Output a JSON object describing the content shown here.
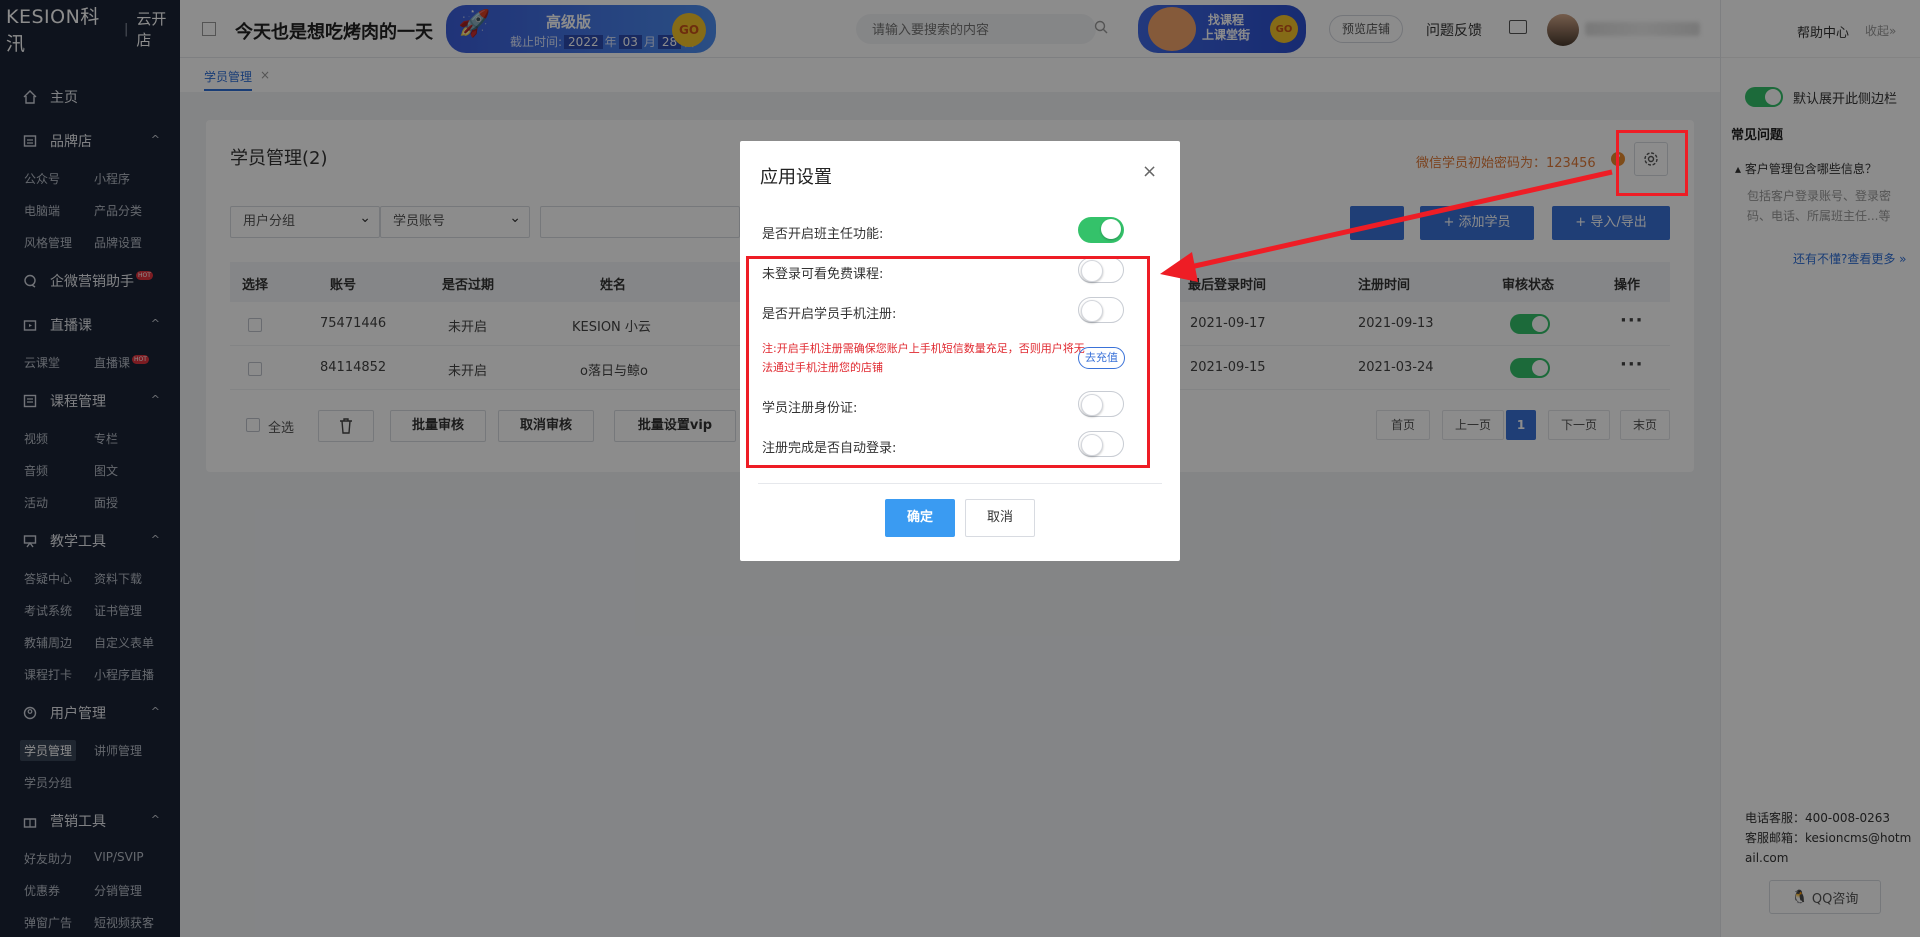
{
  "logo": {
    "brand": "KESION科汛",
    "store": "云开店"
  },
  "header": {
    "title": "今天也是想吃烤肉的一天",
    "banner_pro": {
      "title": "高级版",
      "expire_label": "截止时间:",
      "year": "2022",
      "year_unit": "年",
      "month": "03",
      "month_unit": "月",
      "day": "28",
      "day_unit": "日",
      "go": "GO"
    },
    "search_placeholder": "请输入要搜索的内容",
    "banner_course": {
      "line1": "找课程",
      "line2": "上课堂街",
      "go": "GO"
    },
    "preview_store": "预览店铺",
    "feedback": "问题反馈"
  },
  "sidebar": {
    "home": "主页",
    "sections": [
      {
        "label": "品牌店",
        "items": [
          "公众号",
          "小程序",
          "电脑端",
          "产品分类",
          "风格管理",
          "品牌设置"
        ]
      },
      {
        "label": "企微营销助手",
        "hot": "HOT"
      },
      {
        "label": "直播课",
        "items": [
          "云课堂",
          "直播课"
        ],
        "hot": "HOT"
      },
      {
        "label": "课程管理",
        "items": [
          "视频",
          "专栏",
          "音频",
          "图文",
          "活动",
          "面授"
        ]
      },
      {
        "label": "教学工具",
        "items": [
          "答疑中心",
          "资料下载",
          "考试系统",
          "证书管理",
          "教辅周边",
          "自定义表单",
          "课程打卡",
          "小程序直播"
        ]
      },
      {
        "label": "用户管理",
        "items": [
          "学员管理",
          "讲师管理",
          "学员分组"
        ]
      },
      {
        "label": "营销工具",
        "items": [
          "好友助力",
          "VIP/SVIP",
          "优惠券",
          "分销管理",
          "弹窗广告",
          "短视频获客"
        ]
      }
    ]
  },
  "tabbar": {
    "tab": "学员管理",
    "close": "×"
  },
  "card": {
    "title": "学员管理(2)",
    "password_note": "微信学员初始密码为：123456",
    "question_mark": "?",
    "filters": {
      "group": "用户分组",
      "account": "学员账号"
    },
    "buttons": {
      "add": "+ 添加学员",
      "import_export": "+ 导入/导出"
    },
    "table": {
      "headers": [
        "选择",
        "账号",
        "是否过期",
        "姓名",
        "最后登录时间",
        "注册时间",
        "审核状态",
        "操作"
      ],
      "rows": [
        {
          "account": "75471446",
          "expired": "未开启",
          "name": "KESION 小云",
          "last_login": "2021-09-17",
          "registered": "2021-09-13",
          "approved": true
        },
        {
          "account": "84114852",
          "expired": "未开启",
          "name": "ο落日与鲸ο",
          "last_login": "2021-09-15",
          "registered": "2021-03-24",
          "approved": true
        }
      ]
    },
    "bulk": {
      "select_all": "全选",
      "approve": "批量审核",
      "cancel_approve": "取消审核",
      "set_vip": "批量设置vip"
    },
    "pagination": {
      "first": "首页",
      "prev": "上一页",
      "current": "1",
      "next": "下一页",
      "last": "末页"
    }
  },
  "right_panel": {
    "help": "帮助中心",
    "collapse": "收起»",
    "default_open": "默认展开此侧边栏",
    "faq_title": "常见问题",
    "faq_question": "客户管理包含哪些信息？",
    "faq_answer": "包括客户登录账号、登录密码、电话、所属班主任...等",
    "faq_more": "还有不懂?查看更多 »",
    "phone": "电话客服：400-008-0263",
    "email": "客服邮箱：kesioncms@hotmail.com",
    "qq": "QQ咨询"
  },
  "modal": {
    "title": "应用设置",
    "close": "×",
    "settings": [
      {
        "label": "是否开启班主任功能:",
        "enabled": true
      },
      {
        "label": "未登录可看免费课程:",
        "enabled": false
      },
      {
        "label": "是否开启学员手机注册:",
        "enabled": false
      },
      {
        "label": "学员注册身份证:",
        "enabled": false
      },
      {
        "label": "注册完成是否自动登录:",
        "enabled": false
      }
    ],
    "note": "注:开启手机注册需确保您账户上手机短信数量充足，否则用户将无法通过手机注册您的店铺",
    "recharge": "去充值",
    "confirm": "确定",
    "cancel": "取消"
  },
  "colors": {
    "primary": "#3a72d8",
    "success": "#34c26a",
    "annotation": "#ee1d25",
    "sidebar_bg": "#1a2436"
  }
}
